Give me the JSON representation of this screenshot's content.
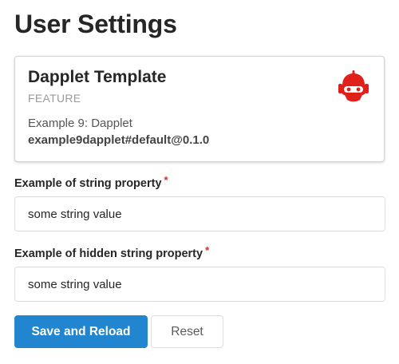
{
  "page": {
    "title": "User Settings"
  },
  "card": {
    "title": "Dapplet Template",
    "meta": "FEATURE",
    "description": "Example 9: Dapplet",
    "identifier": "example9dapplet#default@0.1.0",
    "logo_icon": "dapplet-robot-logo-icon",
    "logo_color": "#e0201b"
  },
  "fields": [
    {
      "label": "Example of string property",
      "required_marker": "*",
      "value": "some string value"
    },
    {
      "label": "Example of hidden string property",
      "required_marker": "*",
      "value": "some string value"
    }
  ],
  "actions": {
    "save_label": "Save and Reload",
    "reset_label": "Reset"
  },
  "colors": {
    "primary": "#2185d0",
    "required": "#db2828"
  }
}
